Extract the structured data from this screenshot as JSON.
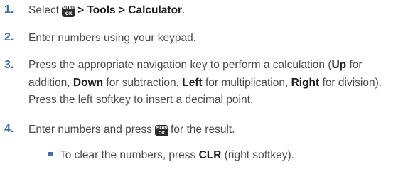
{
  "steps": [
    {
      "number": "1.",
      "select": "Select",
      "menu_key": {
        "top": "MENU",
        "bottom": "OK",
        "icon": "menu-ok-key-icon"
      },
      "path": "> Tools > Calculator",
      "end": "."
    },
    {
      "number": "2.",
      "text": "Enter numbers using your keypad."
    },
    {
      "number": "3.",
      "t1": "Press the appropriate navigation key to perform a calculation (",
      "up": "Up",
      "t2": " for addition, ",
      "down": "Down",
      "t3": " for subtraction, ",
      "left": "Left",
      "t4": " for multiplication, ",
      "right": "Right",
      "t5": " for division). Press the left softkey to insert a decimal point."
    },
    {
      "number": "4.",
      "t1": "Enter numbers and press",
      "menu_key": {
        "top": "MENU",
        "bottom": "OK",
        "icon": "menu-ok-key-icon"
      },
      "t2": "for the result."
    }
  ],
  "bullet": {
    "t1": "To clear the numbers, press ",
    "clr": "CLR",
    "t2": " (right softkey)."
  },
  "colors": {
    "number": "#3d6fa8",
    "body_text": "#4a4a4a",
    "bold_text": "#1f1f1f",
    "key_background": "#2b2b2b"
  }
}
